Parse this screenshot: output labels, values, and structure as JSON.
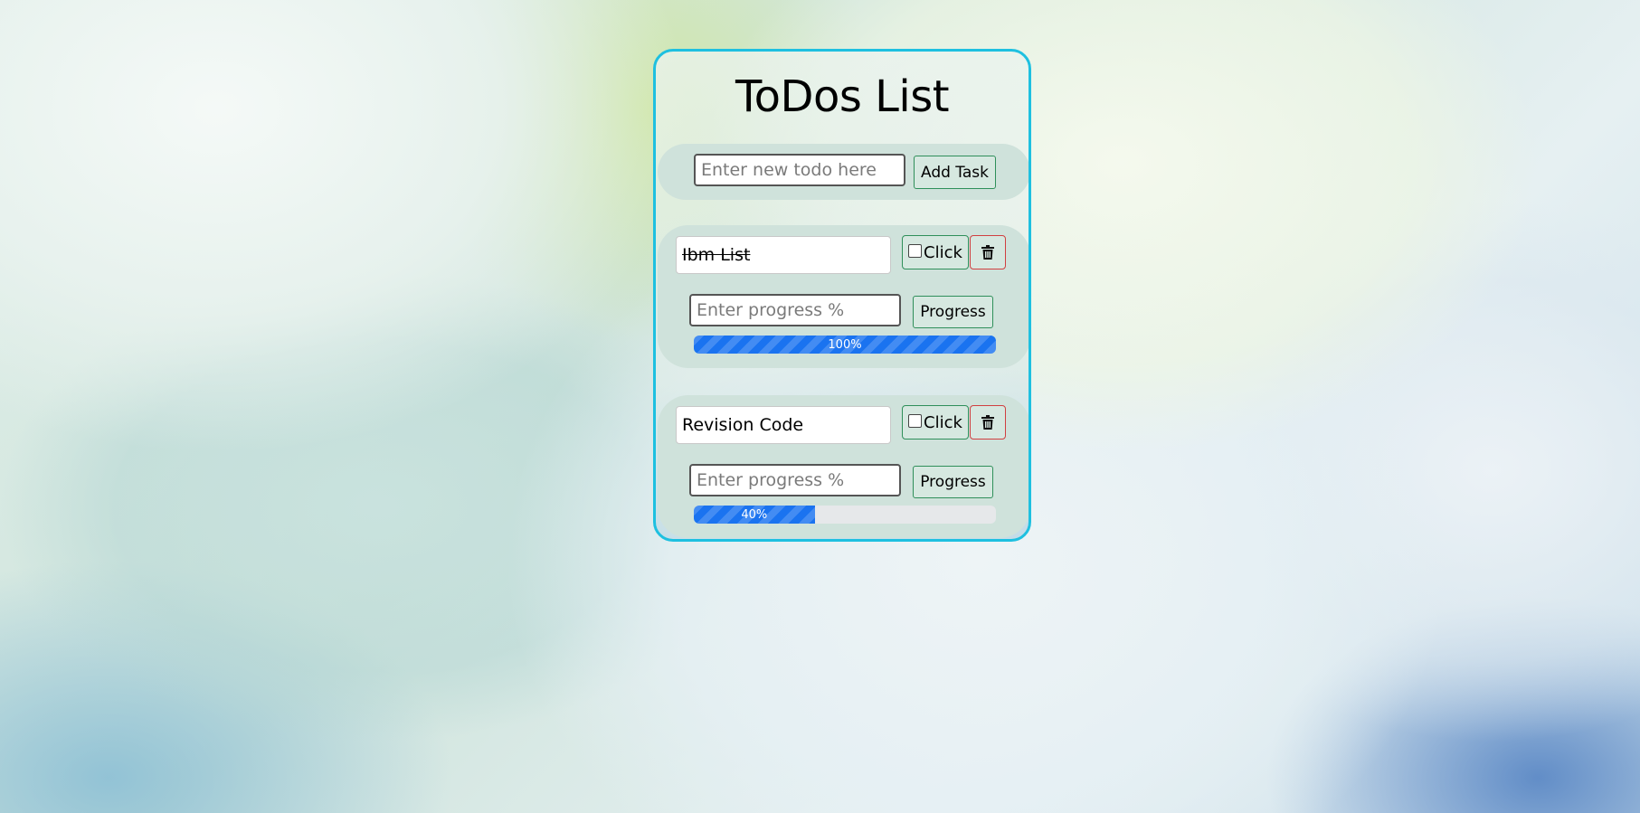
{
  "app": {
    "title": "ToDos List"
  },
  "add_form": {
    "input_placeholder": "Enter new todo here",
    "input_value": "",
    "add_button_label": "Add Task"
  },
  "tasks": [
    {
      "name": "Ibm List",
      "completed_strikethrough": true,
      "checkbox_label": "Click",
      "checked": false,
      "delete_icon": "trash-icon",
      "progress_placeholder": "Enter progress %",
      "progress_button_label": "Progress",
      "progress_percent": 100,
      "progress_text": "100%"
    },
    {
      "name": "Revision Code",
      "completed_strikethrough": false,
      "checkbox_label": "Click",
      "checked": false,
      "delete_icon": "trash-icon",
      "progress_placeholder": "Enter progress %",
      "progress_button_label": "Progress",
      "progress_percent": 40,
      "progress_text": "40%"
    }
  ],
  "colors": {
    "card_border": "#1ec0e0",
    "panel_bg": "#cfe2db",
    "button_border": "#2f8f5a",
    "delete_border": "#d04040",
    "progress_fill": "#1a73f0"
  }
}
